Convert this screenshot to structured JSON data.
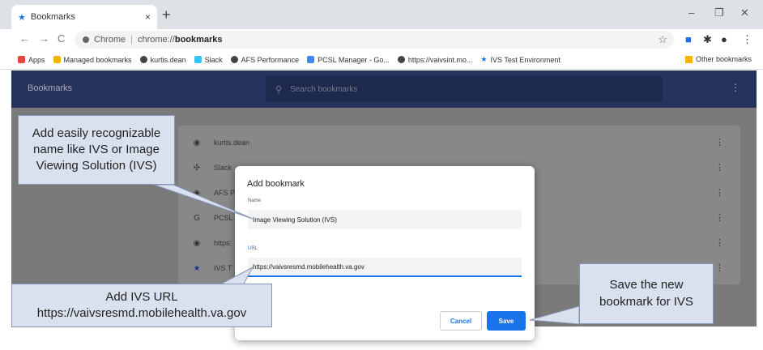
{
  "tab": {
    "title": "Bookmarks",
    "close": "×",
    "new_tab": "+"
  },
  "window_controls": {
    "minimize": "–",
    "restore": "❐",
    "close": "✕"
  },
  "toolbar": {
    "back": "←",
    "forward": "→",
    "reload": "C",
    "url_site": "Chrome",
    "url_scheme": "chrome://",
    "url_path": "bookmarks"
  },
  "bookmarks_bar": {
    "items": [
      {
        "label": "Apps",
        "color": "#e8453c"
      },
      {
        "label": "Managed bookmarks",
        "color": "#f4b400"
      },
      {
        "label": "kurtis.dean",
        "color": "#444444"
      },
      {
        "label": "Slack",
        "color": "#36c5f0"
      },
      {
        "label": "AFS Performance",
        "color": "#444444"
      },
      {
        "label": "PCSL Manager - Go...",
        "color": "#4285f4"
      },
      {
        "label": "https://vaivsint.mo...",
        "color": "#444444"
      },
      {
        "label": "IVS Test Environment",
        "color": "#1a73e8"
      }
    ],
    "other": "Other bookmarks"
  },
  "app": {
    "title": "Bookmarks",
    "search_placeholder": "Search bookmarks"
  },
  "list_rows": [
    {
      "icon": "globe-icon",
      "glyph": "◉",
      "label": "kurtis.dean"
    },
    {
      "icon": "slack-icon",
      "glyph": "✣",
      "label": "Slack"
    },
    {
      "icon": "globe-icon",
      "glyph": "◉",
      "label": "AFS P"
    },
    {
      "icon": "google-icon",
      "glyph": "G",
      "label": "PCSL"
    },
    {
      "icon": "globe-icon",
      "glyph": "◉",
      "label": "https:"
    },
    {
      "icon": "star-icon",
      "glyph": "★",
      "label": "IVS T"
    }
  ],
  "dialog": {
    "title": "Add bookmark",
    "name_label": "Name",
    "name_value": "Image Viewing Solution (IVS)",
    "url_label": "URL",
    "url_value": "https://vaivsresmd.mobilehealth.va.gov",
    "cancel": "Cancel",
    "save": "Save"
  },
  "callouts": {
    "name_hint": "Add easily recognizable name like IVS or Image Viewing Solution (IVS)",
    "url_hint_line1": "Add IVS URL",
    "url_hint_line2": "https://vaivsresmd.mobilehealth.va.gov",
    "save_hint": "Save the new bookmark for IVS"
  },
  "colors": {
    "accent": "#1a73e8",
    "appbar": "#26335c",
    "callout": "#d9e0ee"
  }
}
